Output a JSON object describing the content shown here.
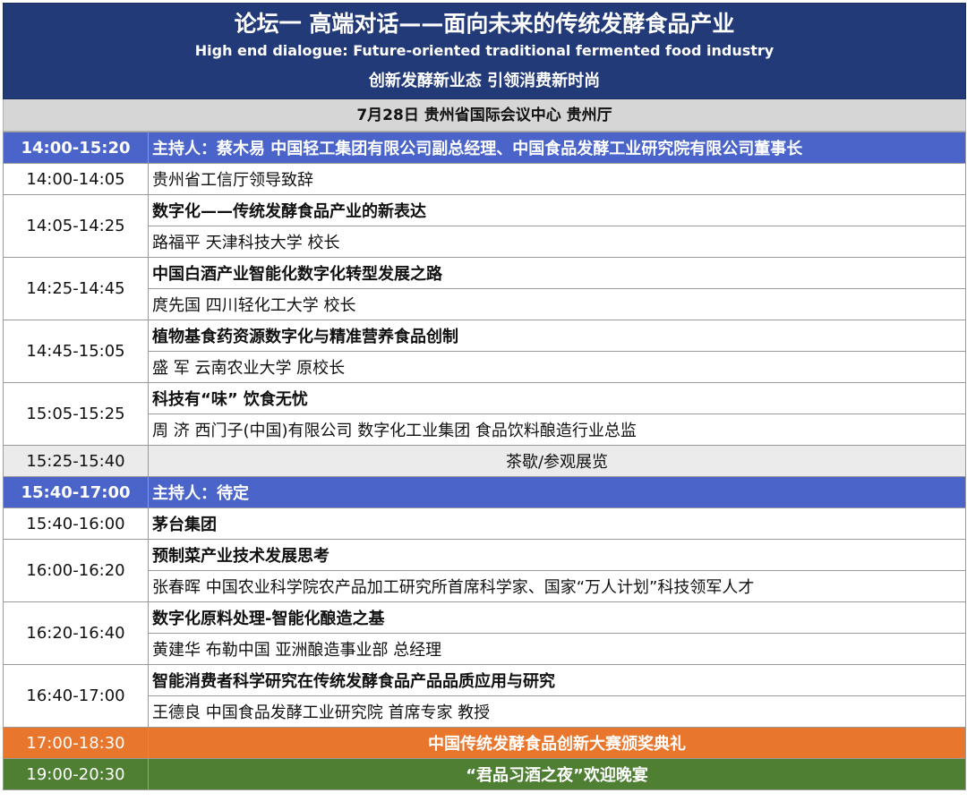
{
  "header": {
    "title_cn": "论坛一 高端对话——面向未来的传统发酵食品产业",
    "title_en": "High end dialogue: Future-oriented traditional fermented food industry",
    "slogan": "创新发酵新业态  引领消费新时尚"
  },
  "venue": "7月28日 贵州省国际会议中心 贵州厅",
  "session1": {
    "time": "14:00-15:20",
    "host": "主持人：蔡木易 中国轻工集团有限公司副总经理、中国食品发酵工业研究院有限公司董事长",
    "items": [
      {
        "time": "14:00-14:05",
        "title": "贵州省工信厅领导致辞"
      },
      {
        "time": "14:05-14:25",
        "title": "数字化——传统发酵食品产业的新表达",
        "speaker": "路福平  天津科技大学 校长"
      },
      {
        "time": "14:25-14:45",
        "title": "中国白酒产业智能化数字化转型发展之路",
        "speaker": "庹先国  四川轻化工大学 校长"
      },
      {
        "time": "14:45-15:05",
        "title": "植物基食药资源数字化与精准营养食品创制",
        "speaker": "盛   军  云南农业大学 原校长"
      },
      {
        "time": "15:05-15:25",
        "title": "科技有“味”  饮食无忧",
        "speaker": "周   济  西门子(中国)有限公司 数字化工业集团 食品饮料酿造行业总监"
      }
    ]
  },
  "break": {
    "time": "15:25-15:40",
    "label": "茶歇/参观展览"
  },
  "session2": {
    "time": "15:40-17:00",
    "host": "主持人：待定",
    "items": [
      {
        "time": "15:40-16:00",
        "title": "茅台集团"
      },
      {
        "time": "16:00-16:20",
        "title": "预制菜产业技术发展思考",
        "speaker": "张春晖 中国农业科学院农产品加工研究所首席科学家、国家“万人计划”科技领军人才"
      },
      {
        "time": "16:20-16:40",
        "title": "数字化原料处理-智能化酿造之基",
        "speaker": "黄建华 布勒中国 亚洲酿造事业部 总经理"
      },
      {
        "time": "16:40-17:00",
        "title": "智能消费者科学研究在传统发酵食品产品品质应用与研究",
        "speaker": "王德良 中国食品发酵工业研究院 首席专家 教授"
      }
    ]
  },
  "ceremony": {
    "time": "17:00-18:30",
    "label": "中国传统发酵食品创新大赛颁奖典礼"
  },
  "gala": {
    "time": "19:00-20:30",
    "label": "“君品习酒之夜”欢迎晚宴"
  }
}
